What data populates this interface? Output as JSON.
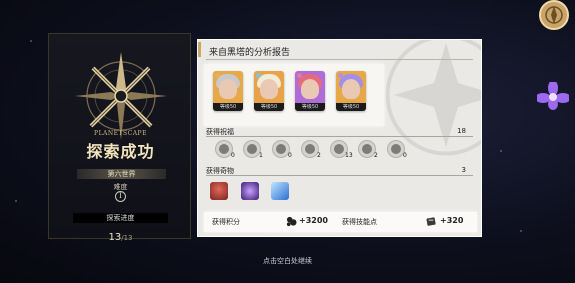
{
  "left_panel": {
    "brand": "PLANETSCAPE",
    "title": "探索成功",
    "world": "第六世界",
    "difficulty_label": "难度",
    "difficulty_value": "I",
    "progress_label": "探索进度",
    "progress_current": "13",
    "progress_total": "/13"
  },
  "report": {
    "heading": "来自黑塔的分析报告",
    "characters": [
      {
        "level": "等级50",
        "element_color": "#d9b85c"
      },
      {
        "level": "等级50",
        "element_color": "#7ec3e6"
      },
      {
        "level": "等级50",
        "element_color": "#e27a9a"
      },
      {
        "level": "等级50",
        "element_color": "#b48ee6"
      }
    ],
    "blessings_label": "获得祝福",
    "blessings_total": "18",
    "blessings": [
      "0",
      "1",
      "0",
      "2",
      "13",
      "2",
      "0"
    ],
    "curios_label": "获得奇物",
    "curios_total": "3",
    "points_label": "获得积分",
    "points_value": "+3200",
    "skill_label": "获得技能点",
    "skill_value": "+320"
  },
  "continue_text": "点击空白处继续",
  "colors": {
    "accent_gold": "#caa767",
    "panel_bg": "#eae9e6"
  }
}
